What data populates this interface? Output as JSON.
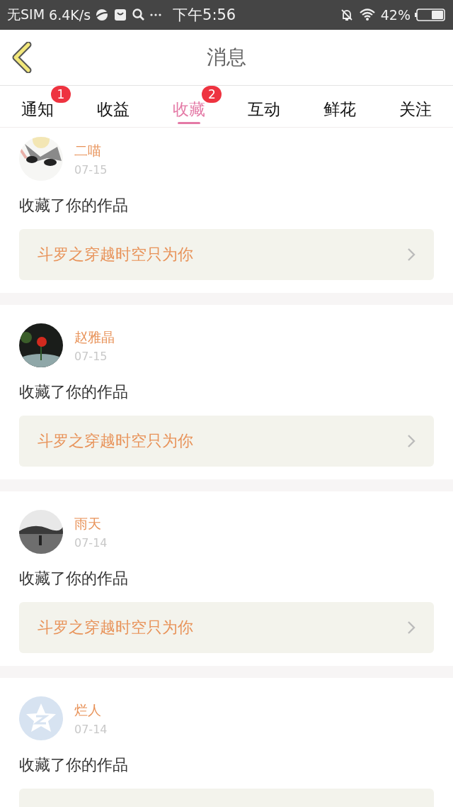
{
  "status_bar": {
    "carrier": "无SIM",
    "speed": "6.4K/s",
    "time": "下午5:56",
    "battery": "42%"
  },
  "header": {
    "title": "消息"
  },
  "tabs": [
    {
      "label": "通知",
      "selected": false,
      "badge": "1"
    },
    {
      "label": "收益",
      "selected": false
    },
    {
      "label": "收藏",
      "selected": true,
      "badge": "2"
    },
    {
      "label": "互动",
      "selected": false
    },
    {
      "label": "鲜花",
      "selected": false
    },
    {
      "label": "关注",
      "selected": false
    }
  ],
  "messages": [
    {
      "name": "二喵",
      "date": "07-15",
      "text": "收藏了你的作品",
      "link": "斗罗之穿越时空只为你"
    },
    {
      "name": "赵雅晶",
      "date": "07-15",
      "text": "收藏了你的作品",
      "link": "斗罗之穿越时空只为你"
    },
    {
      "name": "雨天",
      "date": "07-14",
      "text": "收藏了你的作品",
      "link": "斗罗之穿越时空只为你"
    },
    {
      "name": "烂人",
      "date": "07-14",
      "text": "收藏了你的作品"
    }
  ]
}
